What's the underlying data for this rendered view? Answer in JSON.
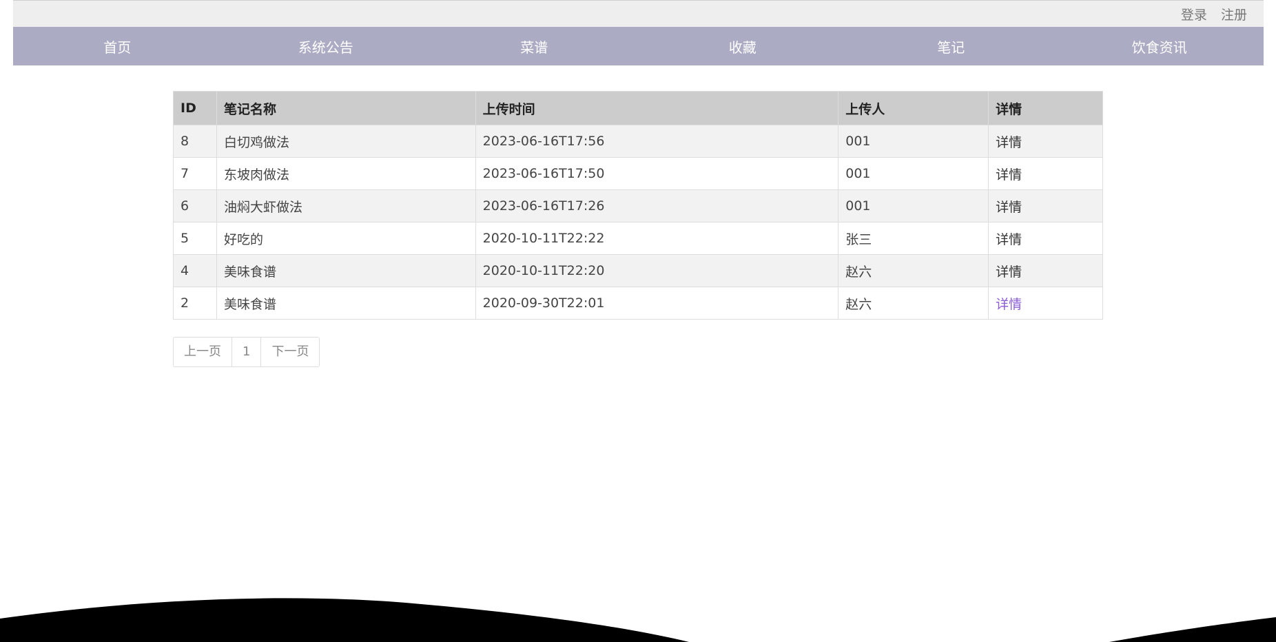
{
  "header": {
    "login_label": "登录",
    "register_label": "注册"
  },
  "nav": {
    "items": [
      {
        "label": "首页"
      },
      {
        "label": "系统公告"
      },
      {
        "label": "菜谱"
      },
      {
        "label": "收藏"
      },
      {
        "label": "笔记"
      },
      {
        "label": "饮食资讯"
      }
    ]
  },
  "table": {
    "headers": [
      "ID",
      "笔记名称",
      "上传时间",
      "上传人",
      "详情"
    ],
    "rows": [
      {
        "id": "8",
        "name": "白切鸡做法",
        "time": "2023-06-16T17:56",
        "uploader": "001",
        "detail": "详情"
      },
      {
        "id": "7",
        "name": "东坡肉做法",
        "time": "2023-06-16T17:50",
        "uploader": "001",
        "detail": "详情"
      },
      {
        "id": "6",
        "name": "油焖大虾做法",
        "time": "2023-06-16T17:26",
        "uploader": "001",
        "detail": "详情"
      },
      {
        "id": "5",
        "name": "好吃的",
        "time": "2020-10-11T22:22",
        "uploader": "张三",
        "detail": "详情"
      },
      {
        "id": "4",
        "name": "美味食谱",
        "time": "2020-10-11T22:20",
        "uploader": "赵六",
        "detail": "详情"
      },
      {
        "id": "2",
        "name": "美味食谱",
        "time": "2020-09-30T22:01",
        "uploader": "赵六",
        "detail": "详情"
      }
    ]
  },
  "pagination": {
    "prev_label": "上一页",
    "current_page": "1",
    "next_label": "下一页"
  },
  "colors": {
    "nav_bg": "#acabc4",
    "visited_link": "#8a5cd8"
  }
}
